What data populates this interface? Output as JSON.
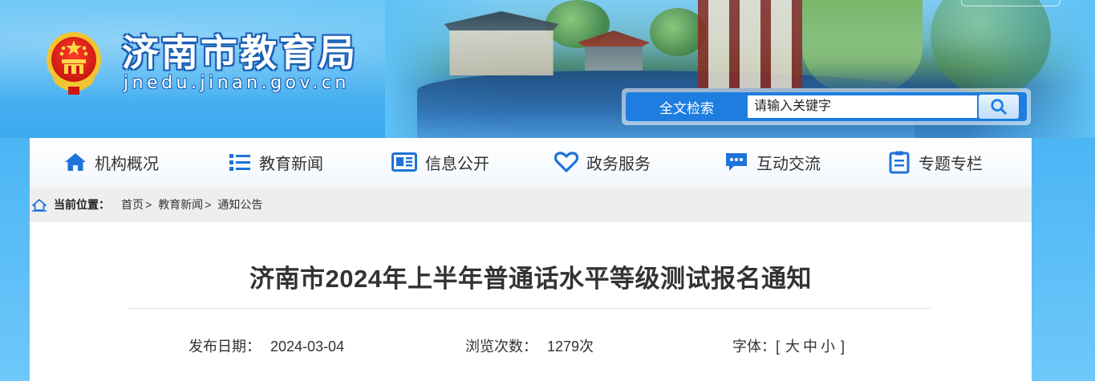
{
  "site": {
    "title": "济南市教育局",
    "domain": "jnedu.jinan.gov.cn"
  },
  "search": {
    "label": "全文检索",
    "placeholder": "请输入关键字",
    "button_icon": "search-icon"
  },
  "nav": {
    "items": [
      {
        "label": "机构概况",
        "icon": "home-icon"
      },
      {
        "label": "教育新闻",
        "icon": "list-icon"
      },
      {
        "label": "信息公开",
        "icon": "newspaper-icon"
      },
      {
        "label": "政务服务",
        "icon": "heart-icon"
      },
      {
        "label": "互动交流",
        "icon": "chat-icon"
      },
      {
        "label": "专题专栏",
        "icon": "clipboard-icon"
      }
    ],
    "icon_color": "#1e73d8"
  },
  "breadcrumb": {
    "prefix": "当前位置：",
    "items": [
      "首页",
      "教育新闻",
      "通知公告"
    ],
    "separator": ">"
  },
  "article": {
    "title": "济南市2024年上半年普通话水平等级测试报名通知",
    "publish_label": "发布日期：",
    "publish_date": "2024-03-04",
    "views_label": "浏览次数：",
    "views_count": "1279次",
    "font_label": "字体：",
    "font_open": "[",
    "font_large": "大",
    "font_medium": "中",
    "font_small": "小",
    "font_close": "]"
  }
}
